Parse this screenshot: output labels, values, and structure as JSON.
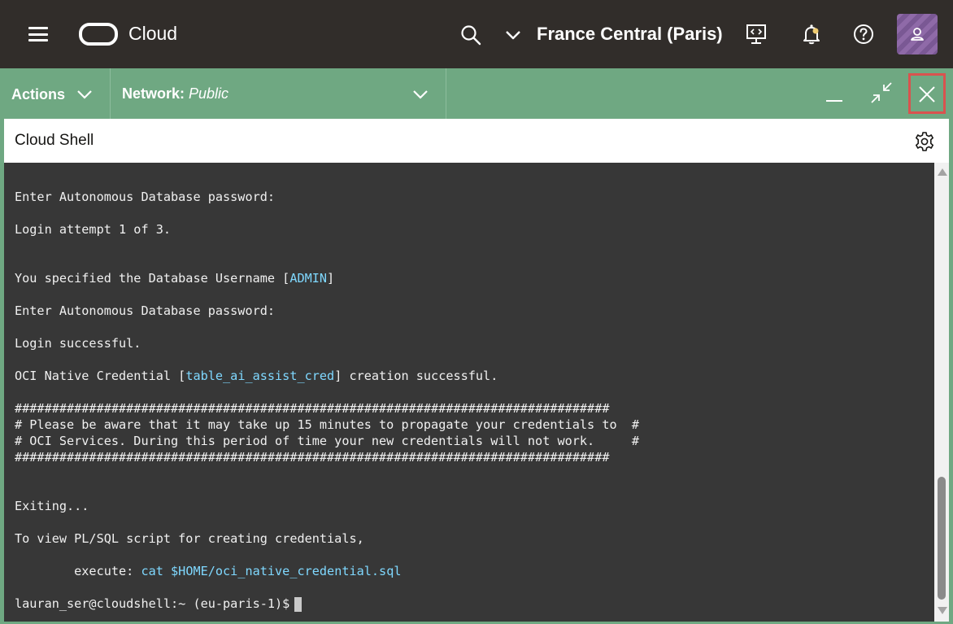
{
  "header": {
    "brand": "Cloud",
    "region": "France Central (Paris)"
  },
  "shell": {
    "actions_label": "Actions",
    "network_label": "Network:",
    "network_value": "Public",
    "title": "Cloud Shell"
  },
  "terminal": {
    "lines": [
      {
        "text": "Enter Autonomous Database password:"
      },
      {
        "text": ""
      },
      {
        "text": "Login attempt 1 of 3."
      },
      {
        "text": ""
      },
      {
        "text": ""
      },
      {
        "text": "You specified the Database Username [",
        "hl": "ADMIN",
        "after": "]"
      },
      {
        "text": ""
      },
      {
        "text": "Enter Autonomous Database password:"
      },
      {
        "text": ""
      },
      {
        "text": "Login successful."
      },
      {
        "text": ""
      },
      {
        "text": "OCI Native Credential [",
        "hl": "table_ai_assist_cred",
        "after": "] creation successful."
      },
      {
        "text": ""
      },
      {
        "text": "################################################################################"
      },
      {
        "text": "# Please be aware that it may take up 15 minutes to propagate your credentials to  #"
      },
      {
        "text": "# OCI Services. During this period of time your new credentials will not work.     #"
      },
      {
        "text": "################################################################################"
      },
      {
        "text": ""
      },
      {
        "text": ""
      },
      {
        "text": "Exiting..."
      },
      {
        "text": ""
      },
      {
        "text": "To view PL/SQL script for creating credentials,"
      },
      {
        "text": ""
      },
      {
        "text": "        execute: ",
        "hl": "cat $HOME/oci_native_credential.sql",
        "after": ""
      },
      {
        "text": ""
      },
      {
        "text": "lauran_ser@cloudshell:~ (eu-paris-1)$",
        "prompt": true
      }
    ]
  },
  "icons": {
    "menu": "hamburger-icon",
    "search": "search-icon",
    "region": "chevron-down-icon",
    "cloud_shell": "cloud-shell-icon",
    "notifications": "bell-icon",
    "help": "help-icon",
    "profile": "user-icon",
    "minimize": "minimize-icon",
    "restore": "restore-icon",
    "close": "close-icon",
    "settings": "gear-icon"
  },
  "colors": {
    "header_bg": "#312d2a",
    "shell_bar": "#6fa882",
    "terminal_bg": "#373737",
    "highlight": "#7fd8ff",
    "close_outline": "#d9534f"
  }
}
